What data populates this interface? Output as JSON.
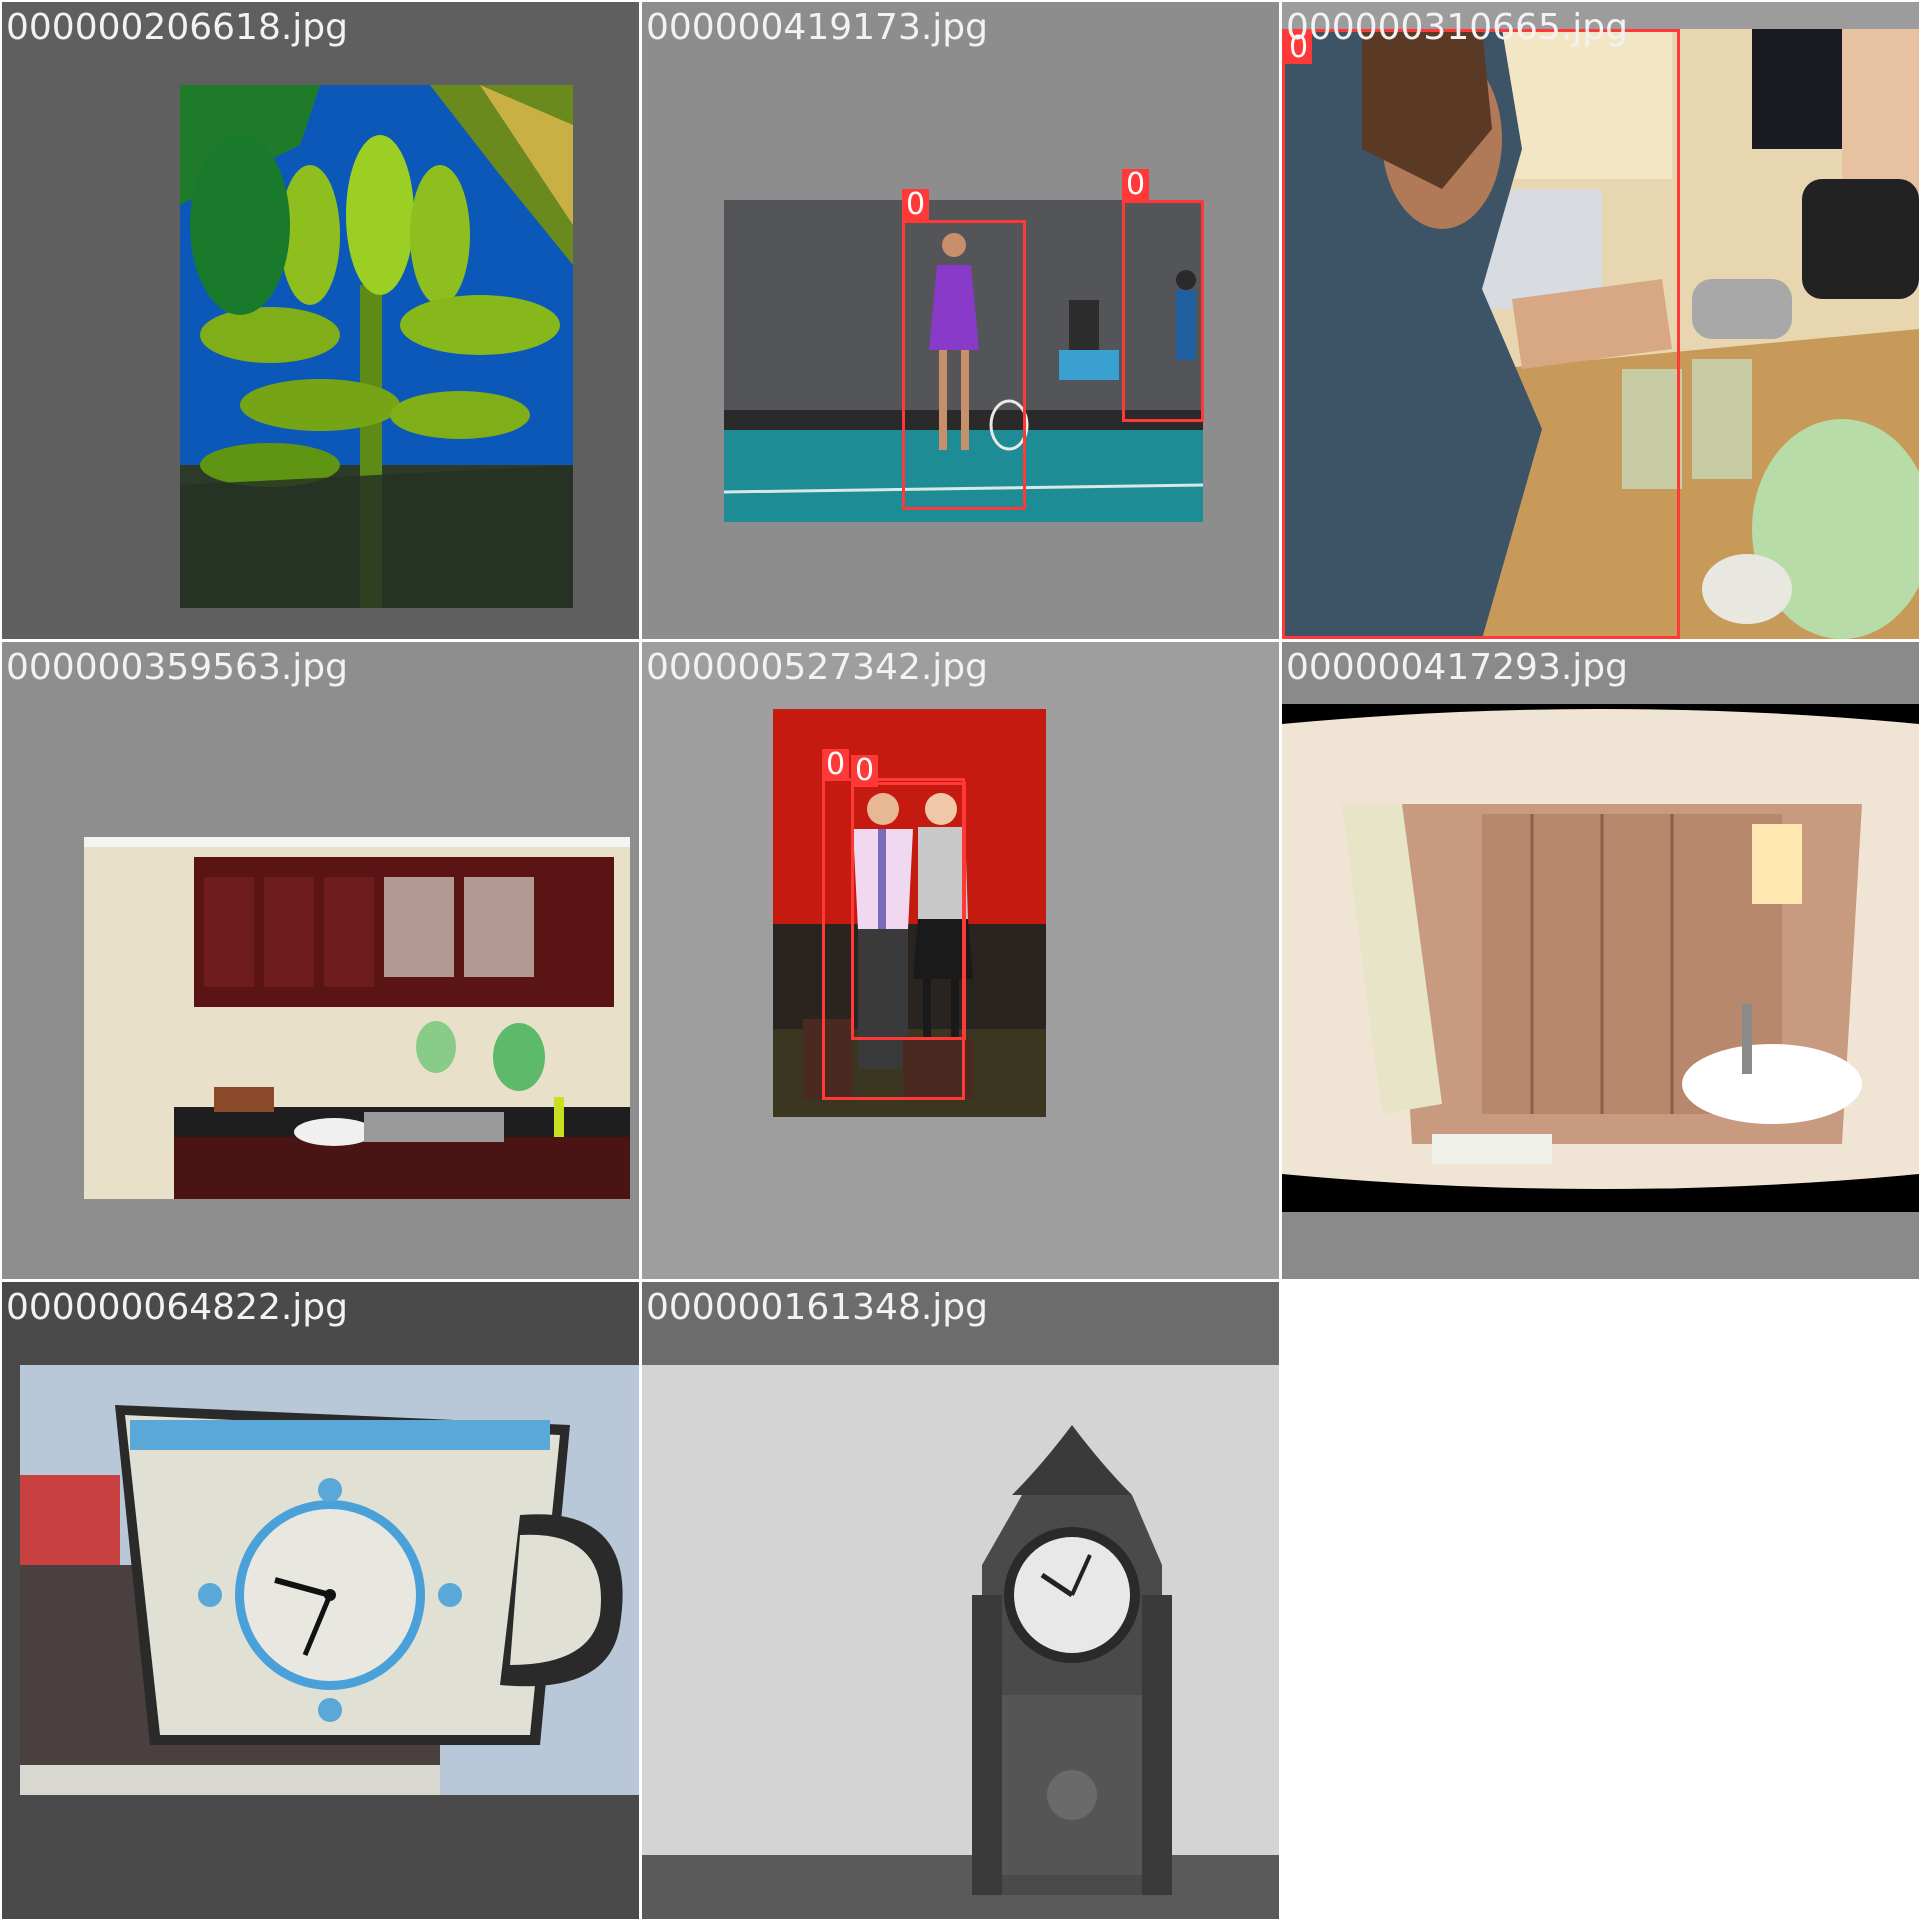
{
  "tiles": [
    {
      "filename": "000000206618.jpg",
      "subject": "banana-bunch",
      "detections": []
    },
    {
      "filename": "000000419173.jpg",
      "subject": "tennis-player",
      "detections": [
        {
          "label": "0"
        },
        {
          "label": "0"
        }
      ]
    },
    {
      "filename": "000000310665.jpg",
      "subject": "kitchen-cooking",
      "detections": [
        {
          "label": "0"
        }
      ]
    },
    {
      "filename": "000000359563.jpg",
      "subject": "kitchen-sink-cabinets",
      "detections": []
    },
    {
      "filename": "000000527342.jpg",
      "subject": "two-people-red-wall",
      "detections": [
        {
          "label": "0"
        },
        {
          "label": "0"
        }
      ]
    },
    {
      "filename": "000000417293.jpg",
      "subject": "panoramic-bathroom",
      "detections": []
    },
    {
      "filename": "000000064822.jpg",
      "subject": "teacup-clock-sign",
      "detections": []
    },
    {
      "filename": "000000161348.jpg",
      "subject": "mantel-clock",
      "detections": []
    }
  ],
  "colors": {
    "box": "#ff3838",
    "label_text": "#ffffff",
    "filename_text": "#f2f2f2"
  }
}
